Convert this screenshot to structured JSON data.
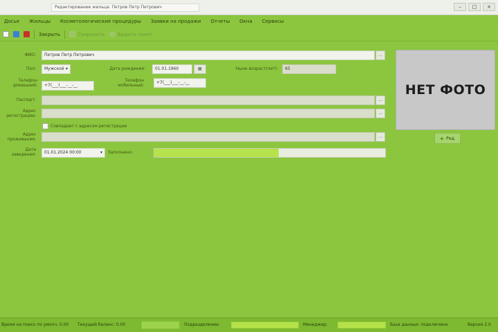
{
  "window": {
    "title": "Редактирование жильца: Петров Петр Петрович",
    "controls": [
      "–",
      "□",
      "×"
    ]
  },
  "menu": [
    "Досье",
    "Жильцы",
    "Косметологические процедуры",
    "Заявки на продажи",
    "Отчеты",
    "Окна",
    "Сервисы"
  ],
  "toolbar": {
    "refresh_label": "Закрыть",
    "save_label": "Сохранить",
    "share_label": "Выдать пакет"
  },
  "form": {
    "fio_label": "ФИО:",
    "fio_value": "Петров Петр Петрович",
    "gender_label": "Пол:",
    "gender_value": "Мужской",
    "birthdate_label": "Дата рождения:",
    "birthdate_value": "01.01.1960",
    "age_label": "Ныне возраст(лет):",
    "age_value": "65",
    "phone_home_label": "Телефон домашний:",
    "phone_home_value": "+7(___)___-__-__",
    "phone_mobile_label": "Телефон мобильный:",
    "phone_mobile_value": "+7(___)___-__-__",
    "passport_label": "Паспорт:",
    "address_label": "Адрес регистрации:",
    "same_address_label": "Совпадает с адресом регистрации",
    "address_live_label": "Адрес проживания:",
    "date_label": "Дата заведения:",
    "date_value": "01.01.2024 00:00",
    "progress_label": "Заполнено:",
    "progress_value": 0.54
  },
  "photo": {
    "no_photo_text": "НЕТ ФОТО",
    "add_label": "Ред."
  },
  "status": {
    "left_text": "Время на поиск по умолч. 0.00",
    "current_label": "Текущий баланс: 0.00",
    "sections_label": "Подразделение:",
    "manager_label": "Менеджер:",
    "db_label": "База данных: подключено",
    "version_label": "Версия 2.0"
  },
  "colors": {
    "background": "#8cc63f",
    "accent": "#b6e34b",
    "field": "#f1f3ec"
  }
}
